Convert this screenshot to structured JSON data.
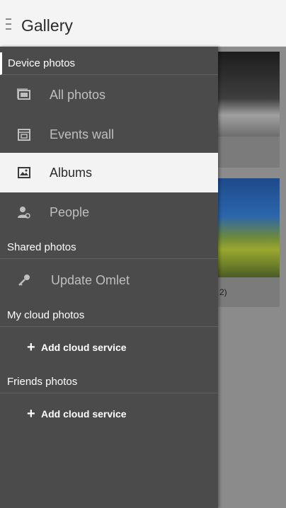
{
  "app": {
    "title": "Gallery"
  },
  "drawer": {
    "device_photos": {
      "header": "Device photos",
      "items": [
        {
          "label": "All photos",
          "icon": "photo-icon"
        },
        {
          "label": "Events wall",
          "icon": "events-icon"
        },
        {
          "label": "Albums",
          "icon": "album-icon",
          "selected": true
        },
        {
          "label": "People",
          "icon": "people-icon"
        }
      ]
    },
    "shared_photos": {
      "header": "Shared photos",
      "items": [
        {
          "label": "Update Omlet",
          "icon": "key-icon"
        }
      ]
    },
    "my_cloud_photos": {
      "header": "My cloud photos",
      "add_label": "Add cloud service",
      "add_symbol": "+"
    },
    "friends_photos": {
      "header": "Friends photos",
      "add_label": "Add cloud service",
      "add_symbol": "+"
    }
  },
  "background": {
    "caption_fragment": "2)"
  },
  "colors": {
    "drawer_bg": "#4b4b4b",
    "selected_bg": "#f3f3f3",
    "appbar_bg": "#f4f4f4"
  }
}
